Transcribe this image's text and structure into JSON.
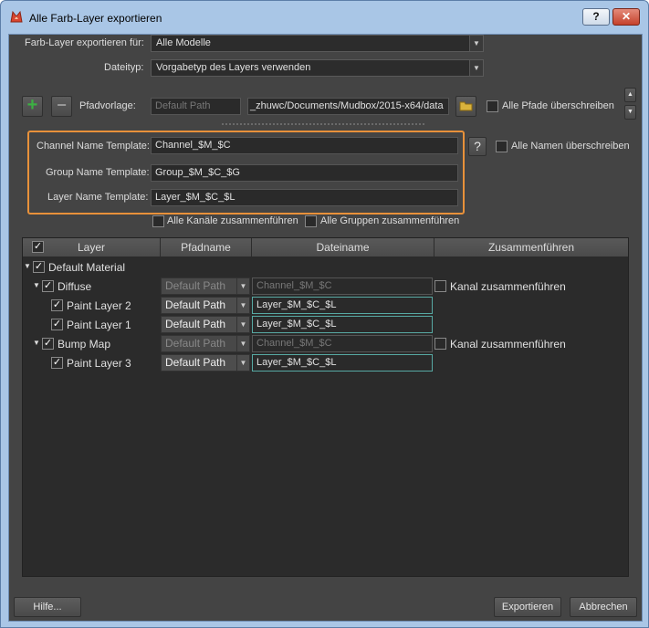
{
  "window": {
    "title": "Alle Farb-Layer exportieren",
    "help_btn": "?",
    "close_btn": "✕"
  },
  "export_for": {
    "label": "Farb-Layer exportieren für:",
    "value": "Alle Modelle"
  },
  "filetype": {
    "label": "Dateityp:",
    "value": "Vorgabetyp des Layers verwenden"
  },
  "path": {
    "label": "Pfadvorlage:",
    "placeholder": "Default Path",
    "value": "_zhuwc/Documents/Mudbox/2015-x64/data",
    "overwrite_label": "Alle Pfade überschreiben"
  },
  "templates": {
    "channel_label": "Channel Name Template:",
    "channel_value": "Channel_$M_$C",
    "group_label": "Group Name Template:",
    "group_value": "Group_$M_$C_$G",
    "layer_label": "Layer Name Template:",
    "layer_value": "Layer_$M_$C_$L",
    "help": "?",
    "overwrite_names_label": "Alle Namen überschreiben"
  },
  "merge": {
    "all_channels": "Alle Kanäle zusammenführen",
    "all_groups": "Alle Gruppen zusammenführen"
  },
  "table": {
    "headers": [
      "Layer",
      "Pfadname",
      "Dateiname",
      "Zusammenführen"
    ],
    "rows": [
      {
        "name": "Default Material"
      },
      {
        "name": "Diffuse",
        "path": "Default Path",
        "file": "Channel_$M_$C",
        "merge": "Kanal zusammenführen"
      },
      {
        "name": "Paint Layer 2",
        "path": "Default Path",
        "file": "Layer_$M_$C_$L"
      },
      {
        "name": "Paint Layer 1",
        "path": "Default Path",
        "file": "Layer_$M_$C_$L"
      },
      {
        "name": "Bump Map",
        "path": "Default Path",
        "file": "Channel_$M_$C",
        "merge": "Kanal zusammenführen"
      },
      {
        "name": "Paint Layer 3",
        "path": "Default Path",
        "file": "Layer_$M_$C_$L"
      }
    ]
  },
  "footer": {
    "help": "Hilfe...",
    "export": "Exportieren",
    "cancel": "Abbrechen"
  },
  "colors": {
    "highlight_box": "#e8913a",
    "teal_border": "#57a9a3",
    "add_green": "#3cb043"
  }
}
